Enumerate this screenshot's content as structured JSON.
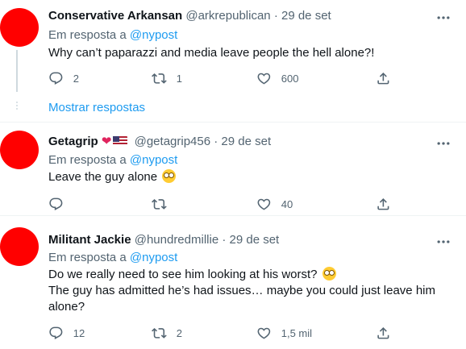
{
  "tweets": [
    {
      "name": "Conservative Arkansan",
      "handle": "@arkrepublican",
      "date": "29 de set",
      "reply_prefix": "Em resposta a",
      "reply_to": "@nypost",
      "lines": [
        "Why can’t paparazzi and media leave people the hell alone?!"
      ],
      "replies": "2",
      "retweets": "1",
      "likes": "600",
      "avatar_color": "#ff0000"
    },
    {
      "name": "Getagrip",
      "handle": "@getagrip456",
      "date": "29 de set",
      "reply_prefix": "Em resposta a",
      "reply_to": "@nypost",
      "lines": [
        "Leave the guy alone"
      ],
      "replies": "",
      "retweets": "",
      "likes": "40",
      "avatar_color": "#ff0000"
    },
    {
      "name": "Militant Jackie",
      "handle": "@hundredmillie",
      "date": "29 de set",
      "reply_prefix": "Em resposta a",
      "reply_to": "@nypost",
      "lines": [
        "Do we really need to see him looking at his worst?",
        "The guy has admitted he’s had issues… maybe you could just leave him",
        "alone?"
      ],
      "replies": "12",
      "retweets": "2",
      "likes": "1,5 mil",
      "avatar_color": "#ff0000"
    }
  ],
  "show_replies_label": "Mostrar respostas",
  "separator": "·",
  "icons": {
    "reply": "reply-icon",
    "retweet": "retweet-icon",
    "like": "like-icon",
    "share": "share-icon",
    "more": "more-icon"
  },
  "colors": {
    "link": "#1d9bf0",
    "secondary_text": "#536471",
    "avatar": "#ff0000"
  }
}
